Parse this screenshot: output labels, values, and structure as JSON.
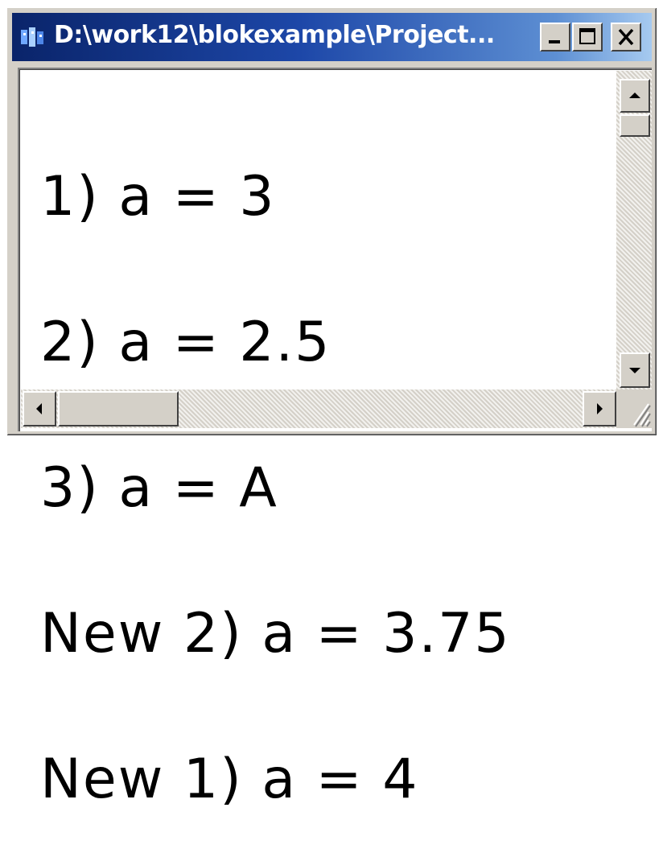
{
  "window": {
    "title": "D:\\work12\\blokexample\\Project...",
    "icon": "console-app-icon",
    "controls": [
      "minimize-icon",
      "maximize-icon",
      "close-icon"
    ]
  },
  "console": {
    "lines": [
      "1) a = 3",
      "2) a = 2.5",
      "3) a = A",
      "New 2) a = 3.75",
      "New 1) a = 4"
    ]
  },
  "scrollbars": {
    "vertical": {
      "icons": [
        "arrow-up-icon",
        "arrow-down-icon"
      ]
    },
    "horizontal": {
      "icons": [
        "arrow-left-icon",
        "arrow-right-icon"
      ]
    }
  },
  "colors": {
    "title_start": "#0a246a",
    "title_end": "#a6caf0",
    "chrome": "#d4d0c8",
    "text": "#000000",
    "background": "#ffffff"
  }
}
